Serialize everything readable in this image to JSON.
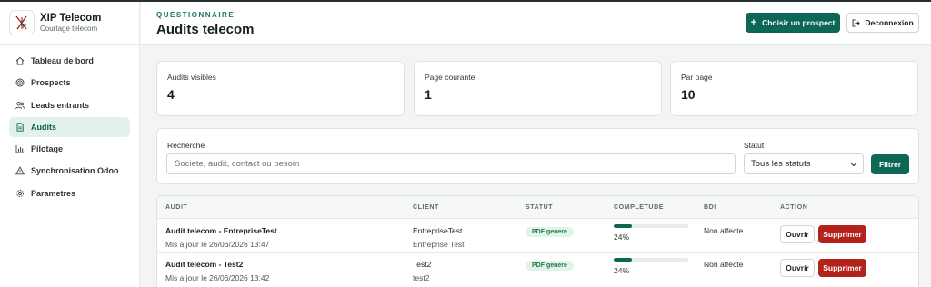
{
  "brand": {
    "name": "XIP Telecom",
    "subtitle": "Courtage telecom",
    "logo_text": "iP"
  },
  "sidebar": {
    "items": [
      {
        "label": "Tableau de bord",
        "icon": "home-icon",
        "active": false
      },
      {
        "label": "Prospects",
        "icon": "target-icon",
        "active": false
      },
      {
        "label": "Leads entrants",
        "icon": "users-icon",
        "active": false
      },
      {
        "label": "Audits",
        "icon": "document-icon",
        "active": true
      },
      {
        "label": "Pilotage",
        "icon": "bar-chart-icon",
        "active": false
      },
      {
        "label": "Synchronisation Odoo",
        "icon": "warning-icon",
        "active": false
      },
      {
        "label": "Parametres",
        "icon": "gear-icon",
        "active": false
      }
    ]
  },
  "header": {
    "eyebrow": "QUESTIONNAIRE",
    "title": "Audits telecom",
    "choose_prospect_label": "Choisir un prospect",
    "logout_label": "Deconnexion"
  },
  "stats": [
    {
      "label": "Audits visibles",
      "value": "4"
    },
    {
      "label": "Page courante",
      "value": "1"
    },
    {
      "label": "Par page",
      "value": "10"
    }
  ],
  "filters": {
    "search_label": "Recherche",
    "search_placeholder": "Societe, audit, contact ou besoin",
    "search_value": "",
    "status_label": "Statut",
    "status_value": "Tous les statuts",
    "filter_button": "Filtrer"
  },
  "table": {
    "columns": [
      "AUDIT",
      "CLIENT",
      "STATUT",
      "COMPLETUDE",
      "BDI",
      "ACTION"
    ],
    "open_label": "Ouvrir",
    "delete_label": "Supprimer",
    "rows": [
      {
        "title": "Audit telecom - EntrepriseTest",
        "updated": "Mis a jour le 26/06/2026 13:47",
        "client": "EntrepriseTest",
        "client_sub": "Entreprise Test",
        "status": "PDF genere",
        "completion_pct": 24,
        "completion_label": "24%",
        "bdi": "Non affecte"
      },
      {
        "title": "Audit telecom - Test2",
        "updated": "Mis a jour le 26/06/2026 13:42",
        "client": "Test2",
        "client_sub": "test2",
        "status": "PDF genere",
        "completion_pct": 24,
        "completion_label": "24%",
        "bdi": "Non affecte"
      }
    ]
  },
  "colors": {
    "accent": "#0d6757",
    "danger": "#b3231c",
    "active_nav_bg": "#e2f1ec",
    "badge_bg": "#e1f4e9",
    "badge_text": "#1f7a4a"
  }
}
